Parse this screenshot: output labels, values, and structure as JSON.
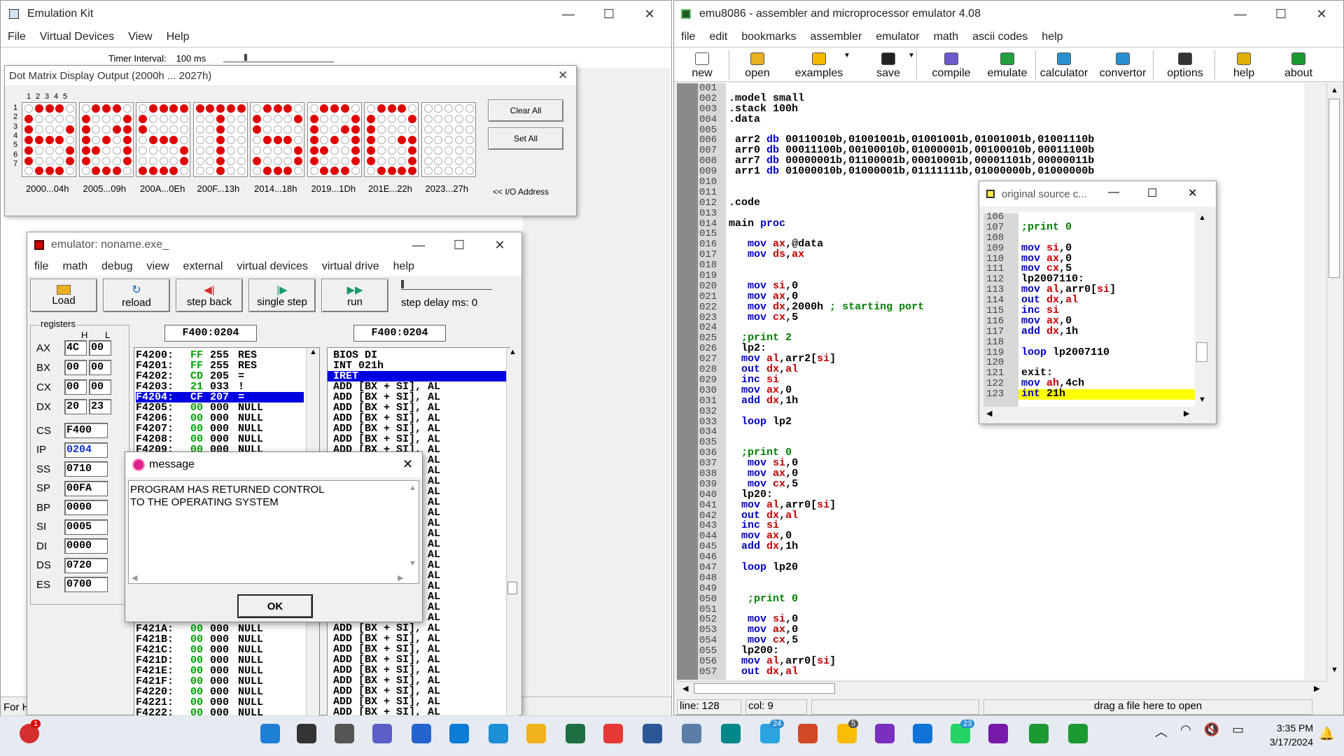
{
  "emulation_kit": {
    "title": "Emulation Kit",
    "menu": [
      "File",
      "Virtual Devices",
      "View",
      "Help"
    ],
    "timer_label": "Timer Interval:",
    "timer_value": "100 ms",
    "status": "For H"
  },
  "dot_matrix": {
    "title": "Dot Matrix Display Output (2000h ... 2027h)",
    "col_labels": [
      "1",
      "2",
      "3",
      "4",
      "5"
    ],
    "row_labels": [
      "1",
      "2",
      "3",
      "4",
      "5",
      "6",
      "7"
    ],
    "addresses": [
      "2000...04h",
      "2005...09h",
      "200A...0Eh",
      "200F...13h",
      "2014...18h",
      "2019...1Dh",
      "201E...22h",
      "2023...27h"
    ],
    "clear_all": "Clear All",
    "set_all": "Set All",
    "io_label": "<< I/O Address",
    "patterns": [
      [
        "01110",
        "10000",
        "10001",
        "11110",
        "10001",
        "10001",
        "01110"
      ],
      [
        "01110",
        "10001",
        "10011",
        "10101",
        "11001",
        "10001",
        "01110"
      ],
      [
        "01111",
        "10000",
        "10000",
        "01110",
        "00001",
        "00001",
        "11110"
      ],
      [
        "11111",
        "00100",
        "00100",
        "00100",
        "00100",
        "00100",
        "00100"
      ],
      [
        "01110",
        "10001",
        "10000",
        "01110",
        "00001",
        "10001",
        "01110"
      ],
      [
        "01110",
        "10001",
        "10011",
        "10101",
        "11001",
        "10001",
        "01110"
      ],
      [
        "01110",
        "10001",
        "10000",
        "10011",
        "10001",
        "10001",
        "01111"
      ],
      [
        "00000",
        "00000",
        "00000",
        "00000",
        "00000",
        "00000",
        "00000"
      ]
    ]
  },
  "emulator": {
    "title": "emulator: noname.exe_",
    "menu": [
      "file",
      "math",
      "debug",
      "view",
      "external",
      "virtual devices",
      "virtual drive",
      "help"
    ],
    "toolbar": {
      "load": "Load",
      "reload": "reload",
      "step_back": "step back",
      "single_step": "single step",
      "run": "run",
      "step_delay": "step delay ms: 0"
    },
    "registers_label": "registers",
    "h_label": "H",
    "l_label": "L",
    "regs8": [
      {
        "name": "AX",
        "h": "4C",
        "l": "00"
      },
      {
        "name": "BX",
        "h": "00",
        "l": "00"
      },
      {
        "name": "CX",
        "h": "00",
        "l": "00"
      },
      {
        "name": "DX",
        "h": "20",
        "l": "23"
      }
    ],
    "regs16": [
      {
        "name": "CS",
        "v": "F400"
      },
      {
        "name": "IP",
        "v": "0204"
      },
      {
        "name": "SS",
        "v": "0710"
      },
      {
        "name": "SP",
        "v": "00FA"
      },
      {
        "name": "BP",
        "v": "0000"
      },
      {
        "name": "SI",
        "v": "0005"
      },
      {
        "name": "DI",
        "v": "0000"
      },
      {
        "name": "DS",
        "v": "0720"
      },
      {
        "name": "ES",
        "v": "0700"
      }
    ],
    "addr1": "F400:0204",
    "addr2": "F400:0204",
    "mem_top": [
      {
        "a": "F4200:",
        "h": "FF",
        "d": "255",
        "c": "RES"
      },
      {
        "a": "F4201:",
        "h": "FF",
        "d": "255",
        "c": "RES"
      },
      {
        "a": "F4202:",
        "h": "CD",
        "d": "205",
        "c": "="
      },
      {
        "a": "F4203:",
        "h": "21",
        "d": "033",
        "c": "!"
      },
      {
        "a": "F4204:",
        "h": "CF",
        "d": "207",
        "c": "="
      },
      {
        "a": "F4205:",
        "h": "00",
        "d": "000",
        "c": "NULL"
      },
      {
        "a": "F4206:",
        "h": "00",
        "d": "000",
        "c": "NULL"
      },
      {
        "a": "F4207:",
        "h": "00",
        "d": "000",
        "c": "NULL"
      },
      {
        "a": "F4208:",
        "h": "00",
        "d": "000",
        "c": "NULL"
      },
      {
        "a": "F4209:",
        "h": "00",
        "d": "000",
        "c": "NULL"
      }
    ],
    "mem_bottom": [
      {
        "a": "F421A:",
        "h": "00",
        "d": "000",
        "c": "NULL"
      },
      {
        "a": "F421B:",
        "h": "00",
        "d": "000",
        "c": "NULL"
      },
      {
        "a": "F421C:",
        "h": "00",
        "d": "000",
        "c": "NULL"
      },
      {
        "a": "F421D:",
        "h": "00",
        "d": "000",
        "c": "NULL"
      },
      {
        "a": "F421E:",
        "h": "00",
        "d": "000",
        "c": "NULL"
      },
      {
        "a": "F421F:",
        "h": "00",
        "d": "000",
        "c": "NULL"
      },
      {
        "a": "F4220:",
        "h": "00",
        "d": "000",
        "c": "NULL"
      },
      {
        "a": "F4221:",
        "h": "00",
        "d": "000",
        "c": "NULL"
      },
      {
        "a": "F4222:",
        "h": "00",
        "d": "000",
        "c": "NULL"
      }
    ],
    "disasm_top": [
      "BIOS DI",
      "INT 021h",
      "IRET"
    ],
    "disasm_repeat": "ADD [BX + SI], AL",
    "disasm_tail": "AL"
  },
  "message": {
    "title": "message",
    "text1": "PROGRAM HAS RETURNED CONTROL",
    "text2": "TO THE OPERATING SYSTEM",
    "ok": "OK"
  },
  "emu8086": {
    "title": "emu8086 - assembler and microprocessor emulator 4.08",
    "menu": [
      "file",
      "edit",
      "bookmarks",
      "assembler",
      "emulator",
      "math",
      "ascii codes",
      "help"
    ],
    "toolbar": [
      "new",
      "open",
      "examples",
      "save",
      "compile",
      "emulate",
      "calculator",
      "convertor",
      "options",
      "help",
      "about"
    ],
    "status": {
      "line": "line: 128",
      "col": "col: 9",
      "drag": "drag a file here to open"
    },
    "code": [
      [
        "001",
        ""
      ],
      [
        "002",
        ".model small"
      ],
      [
        "003",
        ".stack 100h"
      ],
      [
        "004",
        ".data"
      ],
      [
        "005",
        ""
      ],
      [
        "006",
        " arr2 db 00110010b,01001001b,01001001b,01001001b,01001110b"
      ],
      [
        "007",
        " arr0 db 00011100b,00100010b,01000001b,00100010b,00011100b"
      ],
      [
        "008",
        " arr7 db 00000001b,01100001b,00010001b,00001101b,00000011b"
      ],
      [
        "009",
        " arr1 db 01000010b,01000001b,01111111b,01000000b,01000000b"
      ],
      [
        "010",
        ""
      ],
      [
        "011",
        ""
      ],
      [
        "012",
        ".code"
      ],
      [
        "013",
        ""
      ],
      [
        "014",
        "main proc"
      ],
      [
        "015",
        ""
      ],
      [
        "016",
        "   mov ax,@data"
      ],
      [
        "017",
        "   mov ds,ax"
      ],
      [
        "018",
        ""
      ],
      [
        "019",
        ""
      ],
      [
        "020",
        "   mov si,0"
      ],
      [
        "021",
        "   mov ax,0"
      ],
      [
        "022",
        "   mov dx,2000h ; starting port"
      ],
      [
        "023",
        "   mov cx,5"
      ],
      [
        "024",
        ""
      ],
      [
        "025",
        "  ;print 2"
      ],
      [
        "026",
        "  lp2:"
      ],
      [
        "027",
        "  mov al,arr2[si]"
      ],
      [
        "028",
        "  out dx,al"
      ],
      [
        "029",
        "  inc si"
      ],
      [
        "030",
        "  mov ax,0"
      ],
      [
        "031",
        "  add dx,1h"
      ],
      [
        "032",
        ""
      ],
      [
        "033",
        "  loop lp2"
      ],
      [
        "034",
        ""
      ],
      [
        "035",
        ""
      ],
      [
        "036",
        "  ;print 0"
      ],
      [
        "037",
        "   mov si,0"
      ],
      [
        "038",
        "   mov ax,0"
      ],
      [
        "039",
        "   mov cx,5"
      ],
      [
        "040",
        "  lp20:"
      ],
      [
        "041",
        "  mov al,arr0[si]"
      ],
      [
        "042",
        "  out dx,al"
      ],
      [
        "043",
        "  inc si"
      ],
      [
        "044",
        "  mov ax,0"
      ],
      [
        "045",
        "  add dx,1h"
      ],
      [
        "046",
        ""
      ],
      [
        "047",
        "  loop lp20"
      ],
      [
        "048",
        ""
      ],
      [
        "049",
        ""
      ],
      [
        "050",
        "   ;print 0"
      ],
      [
        "051",
        ""
      ],
      [
        "052",
        "   mov si,0"
      ],
      [
        "053",
        "   mov ax,0"
      ],
      [
        "054",
        "   mov cx,5"
      ],
      [
        "055",
        "  lp200:"
      ],
      [
        "056",
        "  mov al,arr0[si]"
      ],
      [
        "057",
        "  out dx,al"
      ]
    ]
  },
  "original_source": {
    "title": "original source c...",
    "code": [
      [
        "106",
        ""
      ],
      [
        "107",
        ";print 0"
      ],
      [
        "108",
        ""
      ],
      [
        "109",
        "mov si,0"
      ],
      [
        "110",
        "mov ax,0"
      ],
      [
        "111",
        "mov cx,5"
      ],
      [
        "112",
        "lp2007110:"
      ],
      [
        "113",
        "mov al,arr0[si]"
      ],
      [
        "114",
        "out dx,al"
      ],
      [
        "115",
        "inc si"
      ],
      [
        "116",
        "mov ax,0"
      ],
      [
        "117",
        "add dx,1h"
      ],
      [
        "118",
        ""
      ],
      [
        "119",
        "loop lp2007110"
      ],
      [
        "120",
        ""
      ],
      [
        "121",
        "exit:"
      ],
      [
        "122",
        "mov ah,4ch"
      ],
      [
        "123",
        "int 21h"
      ]
    ]
  },
  "taskbar": {
    "time": "3:35 PM",
    "date": "3/17/2024",
    "badges": {
      "telegram": "24",
      "whatsapp": "23",
      "chrome2": "5",
      "notify": "1"
    }
  }
}
